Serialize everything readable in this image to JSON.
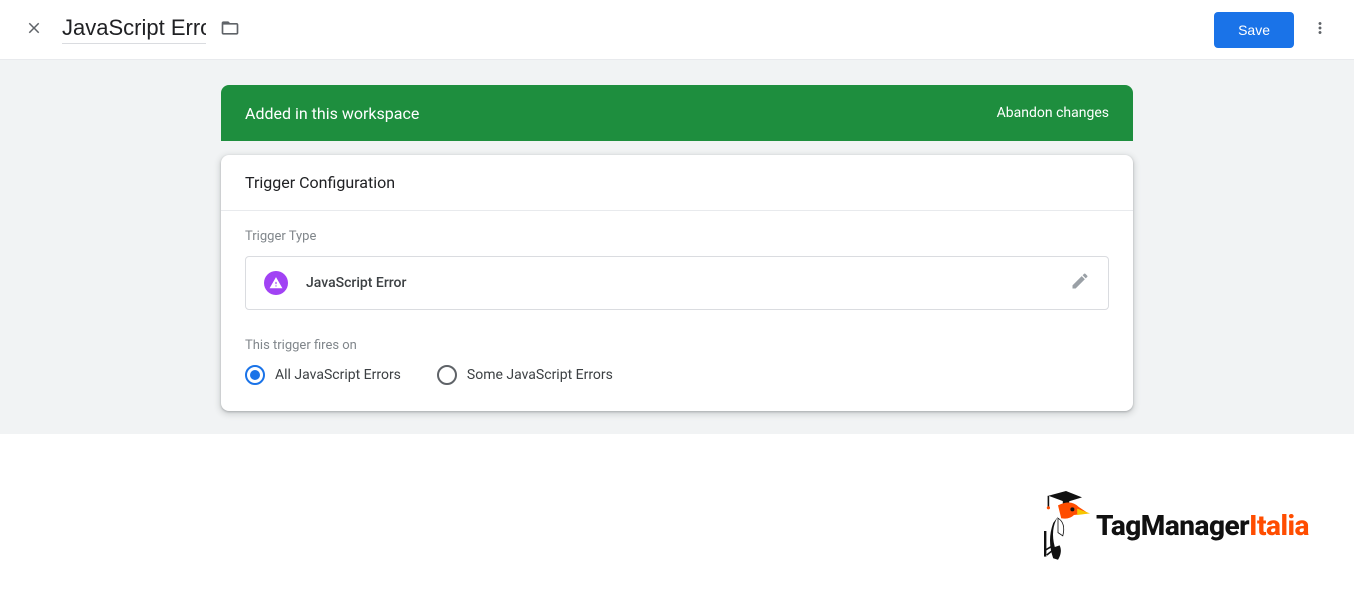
{
  "header": {
    "title": "JavaScript Error",
    "save_label": "Save"
  },
  "banner": {
    "message": "Added in this workspace",
    "action_label": "Abandon changes"
  },
  "panel": {
    "title": "Trigger Configuration",
    "trigger_type_label": "Trigger Type",
    "trigger_type_name": "JavaScript Error",
    "fires_on_label": "This trigger fires on",
    "radios": {
      "all": "All JavaScript Errors",
      "some": "Some JavaScript Errors",
      "selected": "all"
    }
  },
  "footer": {
    "brand_main": "TagManager",
    "brand_suffix": "Italia"
  }
}
